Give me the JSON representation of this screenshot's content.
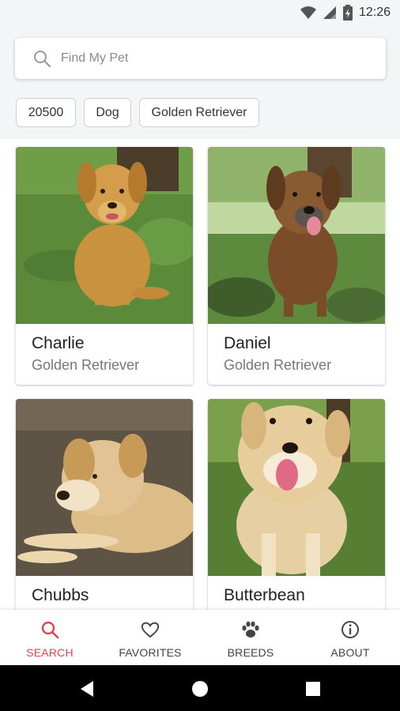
{
  "status_bar": {
    "time": "12:26",
    "icons": [
      "wifi-icon",
      "signal-icon",
      "battery-icon"
    ]
  },
  "search": {
    "placeholder": "Find My Pet",
    "value": ""
  },
  "filters": [
    "20500",
    "Dog",
    "Golden Retriever"
  ],
  "pets": [
    {
      "name": "Charlie",
      "breed": "Golden Retriever"
    },
    {
      "name": "Daniel",
      "breed": "Golden Retriever"
    },
    {
      "name": "Chubbs",
      "breed": ""
    },
    {
      "name": "Butterbean",
      "breed": ""
    }
  ],
  "nav": [
    {
      "label": "SEARCH",
      "icon": "search-icon",
      "active": true
    },
    {
      "label": "FAVORITES",
      "icon": "heart-icon",
      "active": false
    },
    {
      "label": "BREEDS",
      "icon": "paw-icon",
      "active": false
    },
    {
      "label": "ABOUT",
      "icon": "info-icon",
      "active": false
    }
  ],
  "colors": {
    "accent": "#e8404c",
    "background": "#f4f5f7",
    "card": "#ffffff"
  }
}
